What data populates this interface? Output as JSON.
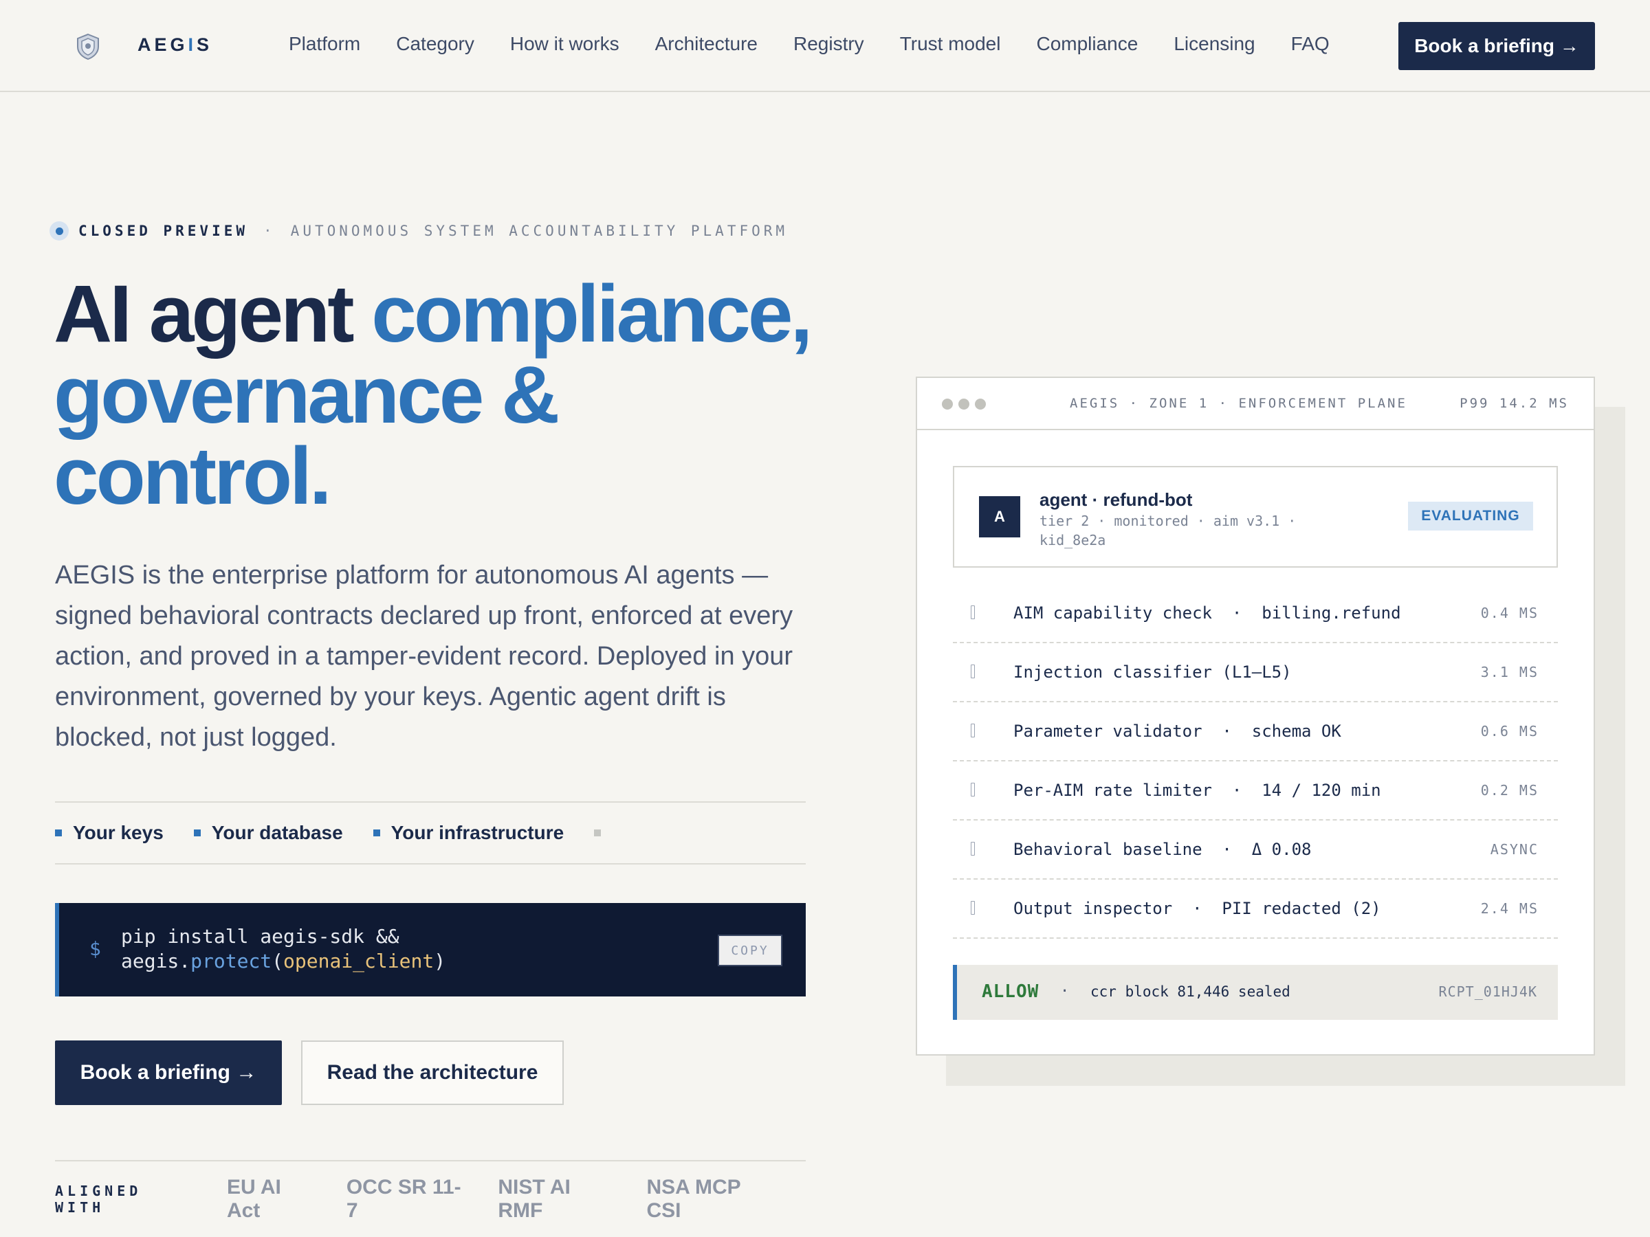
{
  "nav": {
    "brand": "AEGIS",
    "links": [
      "Platform",
      "Category",
      "How it works",
      "Architecture",
      "Registry",
      "Trust model",
      "Compliance",
      "Licensing",
      "FAQ"
    ],
    "cta": "Book a briefing →"
  },
  "hero": {
    "eyebrow_status": "CLOSED PREVIEW",
    "eyebrow_sep": "·",
    "eyebrow_desc": "AUTONOMOUS SYSTEM ACCOUNTABILITY PLATFORM",
    "headline_plain": "AI agent",
    "headline_accent_1": "compliance,",
    "headline_accent_2": "governance &",
    "headline_accent_3": "control.",
    "lede": "AEGIS is the enterprise platform for autonomous AI agents — signed behavioral contracts declared up front, enforced at every action, and proved in a tamper-evident record. Deployed in your environment, governed by your keys. Agentic agent drift is blocked, not just logged.",
    "pillars": [
      "Your keys",
      "Your database",
      "Your infrastructure"
    ],
    "install": {
      "prompt": "$",
      "line1": "pip install aegis-sdk &&",
      "line2_obj": "aegis.",
      "line2_fn": "protect",
      "line2_open": "(",
      "line2_arg": "openai_client",
      "line2_close": ")",
      "copy_label": "COPY"
    },
    "primary_cta": "Book a briefing →",
    "secondary_cta": "Read the architecture",
    "aligned_label": "ALIGNED WITH",
    "aligned_items": [
      "EU AI Act",
      "OCC SR 11-7",
      "NIST AI RMF",
      "NSA MCP CSI"
    ]
  },
  "panel": {
    "title": "AEGIS · ZONE 1 · ENFORCEMENT PLANE",
    "latency": "P99 14.2 MS",
    "agent": {
      "avatar": "A",
      "name": "agent · refund-bot",
      "meta": "tier 2 · monitored · aim v3.1 · kid_8e2a",
      "status": "EVALUATING"
    },
    "checks": [
      {
        "text": "AIM capability check  ·  billing.refund",
        "time": "0.4 MS"
      },
      {
        "text": "Injection classifier (L1–L5)",
        "time": "3.1 MS"
      },
      {
        "text": "Parameter validator  ·  schema OK",
        "time": "0.6 MS"
      },
      {
        "text": "Per-AIM rate limiter  ·  14 / 120 min",
        "time": "0.2 MS"
      },
      {
        "text": "Behavioral baseline  ·  Δ 0.08",
        "time": "ASYNC"
      },
      {
        "text": "Output inspector  ·  PII redacted (2)",
        "time": "2.4 MS"
      }
    ],
    "verdict": {
      "word": "ALLOW",
      "sep": "·",
      "detail": "ccr block 81,446 sealed",
      "receipt": "RCPT_01HJ4K"
    }
  },
  "colors": {
    "background": "#f6f5f1",
    "navy": "#1b2a4a",
    "accent_blue": "#2e73b8",
    "allow_green": "#2e7a3b",
    "code_bg": "#0f1a33"
  }
}
